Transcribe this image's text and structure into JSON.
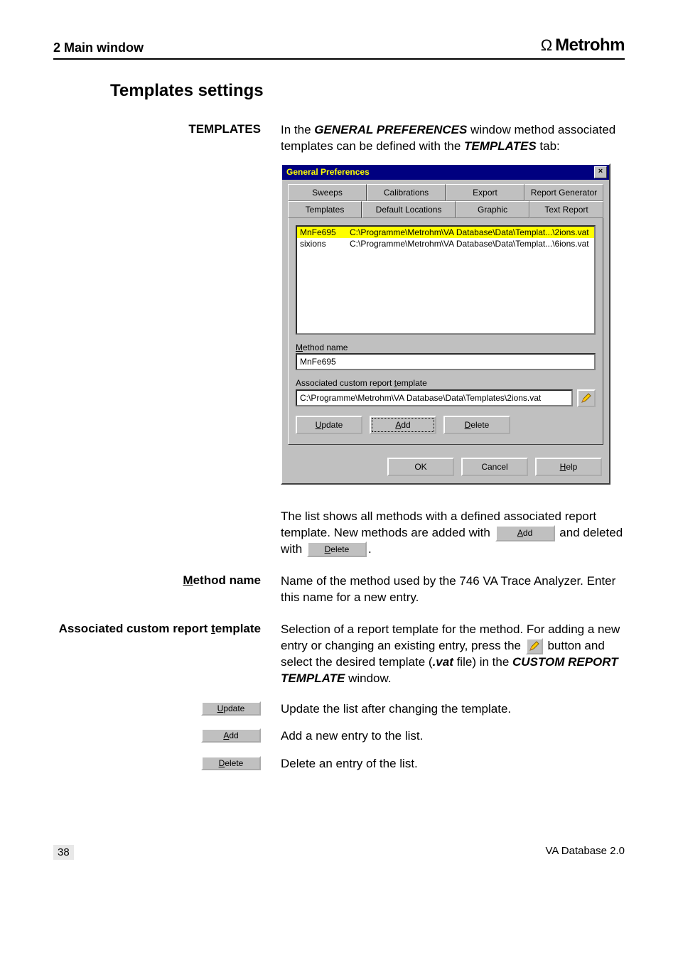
{
  "page": {
    "header_section": "2  Main window",
    "brand": "Metrohm",
    "section_title": "Templates settings",
    "number": "38",
    "footer_right": "VA Database 2.0"
  },
  "intro": {
    "left_label": "TEMPLATES",
    "text_before": "In the ",
    "italic1": "GENERAL PREFERENCES",
    "text_mid": " window method associated templates can be defined with the ",
    "italic2": "TEMPLATES",
    "text_after": " tab:"
  },
  "dialog": {
    "title": "General Preferences",
    "tabs_row1": [
      "Sweeps",
      "Calibrations",
      "Export",
      "Report Generator"
    ],
    "tabs_row2": [
      "Templates",
      "Default Locations",
      "Graphic",
      "Text Report"
    ],
    "list": [
      {
        "name": "MnFe695",
        "path": "C:\\Programme\\Metrohm\\VA Database\\Data\\Templat...\\2ions.vat"
      },
      {
        "name": "sixions",
        "path": "C:\\Programme\\Metrohm\\VA Database\\Data\\Templat...\\6ions.vat"
      }
    ],
    "method_label_pre": "M",
    "method_label_post": "ethod name",
    "method_value": "MnFe695",
    "assoc_label_pre": "Associated custom report ",
    "assoc_label_u": "t",
    "assoc_label_post": "emplate",
    "assoc_value": "C:\\Programme\\Metrohm\\VA Database\\Data\\Templates\\2ions.vat",
    "btns": {
      "update_u": "U",
      "update_rest": "pdate",
      "add_u": "A",
      "add_rest": "dd",
      "delete_u": "D",
      "delete_rest": "elete"
    },
    "footer": {
      "ok": "OK",
      "cancel": "Cancel",
      "help_u": "H",
      "help_rest": "elp"
    }
  },
  "para_list": {
    "text1": "The list shows all methods with a defined associated report template. New methods are added with ",
    "add_u": "A",
    "add_rest": "dd",
    "text2": " and deleted with ",
    "del_u": "D",
    "del_rest": "elete",
    "text3": "."
  },
  "method_block": {
    "left_pre": "M",
    "left_post": "ethod name",
    "text": "Name of the method used by the 746 VA Trace Analyzer. Enter this name for a new entry."
  },
  "assoc_block": {
    "left_pre": "Associated custom report ",
    "left_u": "t",
    "left_post": "emplate",
    "t1": "Selection of a report template for the method. For adding a new entry or changing an existing entry, press the ",
    "t2": " button and select the desired template (",
    "vat": ".vat",
    "t3": " file) in the ",
    "win1": "CUSTOM REPORT TEMPLATE",
    "t4": " window."
  },
  "update_block": {
    "u": "U",
    "rest": "pdate",
    "text": "Update the list after changing the template."
  },
  "add_block": {
    "u": "A",
    "rest": "dd",
    "text": "Add a new entry to the list."
  },
  "delete_block": {
    "u": "D",
    "rest": "elete",
    "text": "Delete an entry of the list."
  }
}
